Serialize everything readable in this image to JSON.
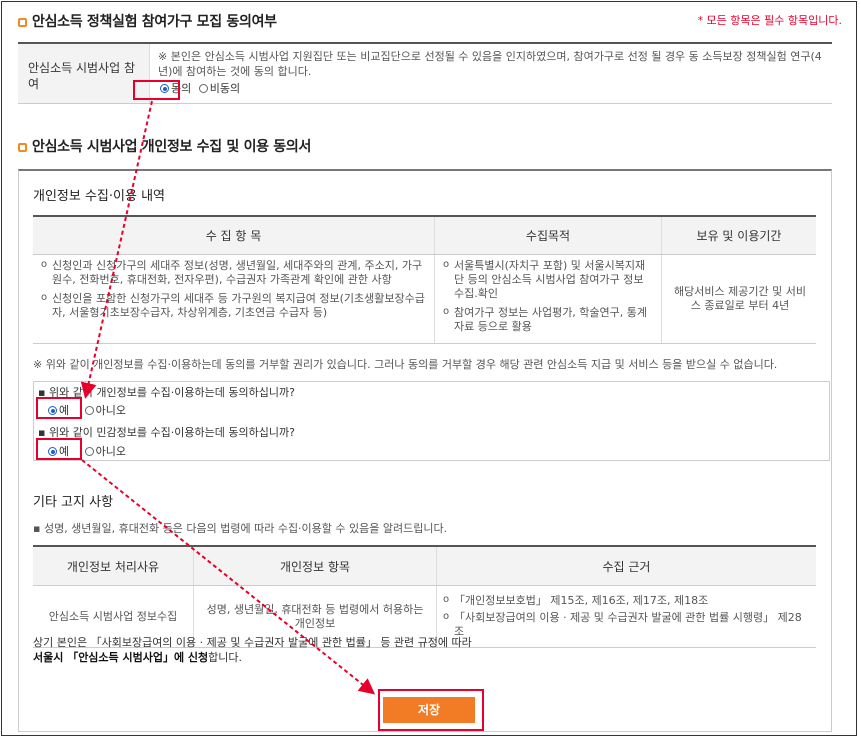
{
  "section1": {
    "title": "안심소득 정책실험 참여가구 모집 동의여부",
    "required_note": "* 모든 항목은 필수 항목입니다.",
    "row_label": "안심소득 시범사업 참여",
    "description": "※ 본인은 안심소득 시범사업 지원집단 또는 비교집단으로 선정될 수 있음을 인지하였으며, 참여가구로 선정 될 경우 동 소득보장 정책실험 연구(4년)에 참여하는 것에 동의 합니다.",
    "options": [
      {
        "label": "동의",
        "checked": true
      },
      {
        "label": "비동의",
        "checked": false
      }
    ]
  },
  "section2": {
    "title": "안심소득 시범사업 개인정보 수집 및 이용 동의서",
    "sub_title": "개인정보 수집·이용 내역",
    "table": {
      "headers": [
        "수 집 항 목",
        "수집목적",
        "보유 및 이용기간"
      ],
      "items_col": [
        "신청인과 신청가구의 세대주 정보(성명, 생년월일, 세대주와의 관계, 주소지, 가구 원수, 전화번호, 휴대전화, 전자우편), 수급권자 가족관계 확인에 관한 사항",
        "신청인을 포함한 신청가구의 세대주 등 가구원의 복지급여 정보(기초생활보장수급자, 서울형기초보장수급자, 차상위계층, 기초연금 수급자 등)"
      ],
      "purpose_col": [
        "서울특별시(자치구 포함) 및 서울시복지재단 등의 안심소득 시범사업 참여가구 정보 수집.확인",
        "참여가구 정보는 사업평가, 학술연구, 통계자료 등으로 활용"
      ],
      "period": "해당서비스 제공기간 및 서비스 종료일로 부터 4년"
    },
    "notice": "※ 위와 같이 개인정보를 수집·이용하는데 동의를 거부할 권리가 있습니다. 그러나 동의를 거부할 경우 해당 관련 안심소득 지급 및 서비스 등을 받으실 수 없습니다.",
    "questions": [
      {
        "text": "▪ 위와 같이 개인정보를 수집·이용하는데 동의하십니까?",
        "yes": "예",
        "no": "아니오"
      },
      {
        "text": "▪ 위와 같이 민감정보를 수집·이용하는데 동의하십니까?",
        "yes": "예",
        "no": "아니오"
      }
    ],
    "other_title": "기타 고지 사항",
    "other_note": "▪ 성명, 생년월일, 휴대전화 등은 다음의 법령에 따라 수집·이용할 수 있음을 알려드립니다.",
    "table2": {
      "headers": [
        "개인정보 처리사유",
        "개인정보 항목",
        "수집 근거"
      ],
      "reason": "안심소득 시범사업 정보수집",
      "items": "성명, 생년월일, 휴대전화 등 법령에서 허용하는 개인정보",
      "basis": [
        "「개인정보보호법」 제15조, 제16조, 제17조, 제18조",
        "「사회보장급여의 이용 · 제공 및 수급권자 발굴에 관한 법률 시행령」 제28조"
      ]
    },
    "footer_line1": "상기 본인은 「사회보장급여의 이용 · 제공 및 수급권자 발굴에 관한 법률」 등 관련 규정에 따라",
    "footer_line2_bold": "서울시 「안심소득 시범사업」에 신청",
    "footer_line2_rest": "합니다.",
    "save_label": "저장"
  },
  "colors": {
    "accent": "#f27b25",
    "highlight": "#e8002d",
    "radio": "#1a5fd0"
  }
}
